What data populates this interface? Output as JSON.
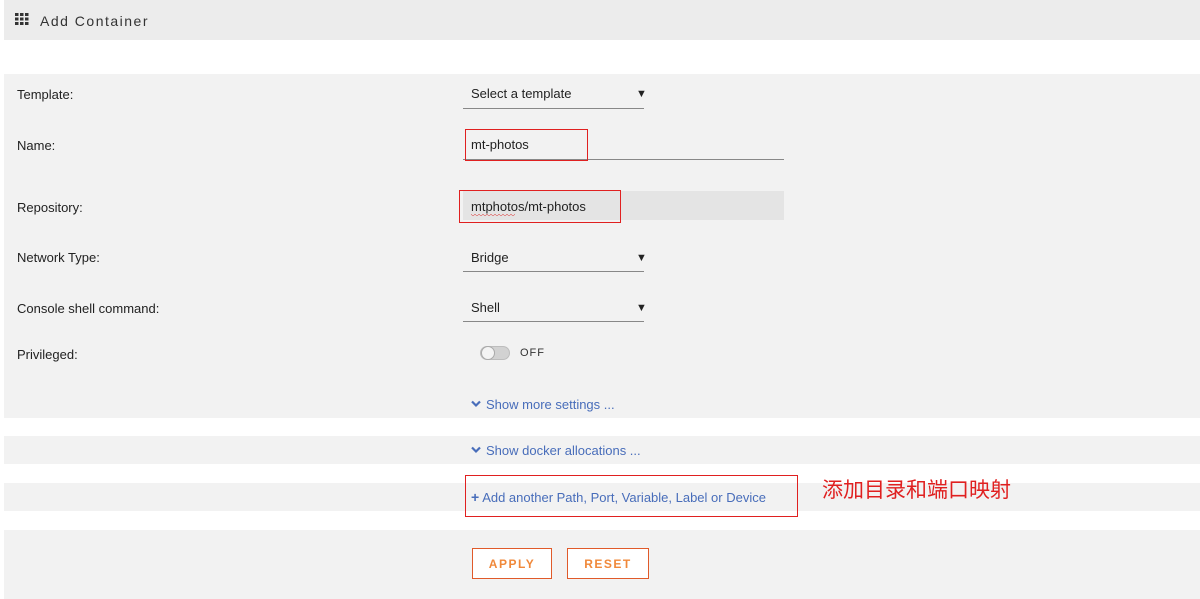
{
  "header": {
    "title": "Add Container",
    "icon": "grid-icon"
  },
  "form": {
    "template": {
      "label": "Template:",
      "value": "Select a template"
    },
    "name": {
      "label": "Name:",
      "value": "mt-photos"
    },
    "repository": {
      "label": "Repository:",
      "value": "mtphotos/mt-photos"
    },
    "network_type": {
      "label": "Network Type:",
      "value": "Bridge"
    },
    "console": {
      "label": "Console shell command:",
      "value": "Shell"
    },
    "privileged": {
      "label": "Privileged:",
      "state": "OFF"
    }
  },
  "links": {
    "more_settings": "Show more settings ...",
    "docker_allocations": "Show docker allocations ...",
    "add_path": "Add another Path, Port, Variable, Label or Device"
  },
  "annotation": "添加目录和端口映射",
  "buttons": {
    "apply": "APPLY",
    "reset": "RESET"
  },
  "colors": {
    "accent": "#f0883a",
    "link": "#486dba",
    "highlight": "#e02020"
  }
}
